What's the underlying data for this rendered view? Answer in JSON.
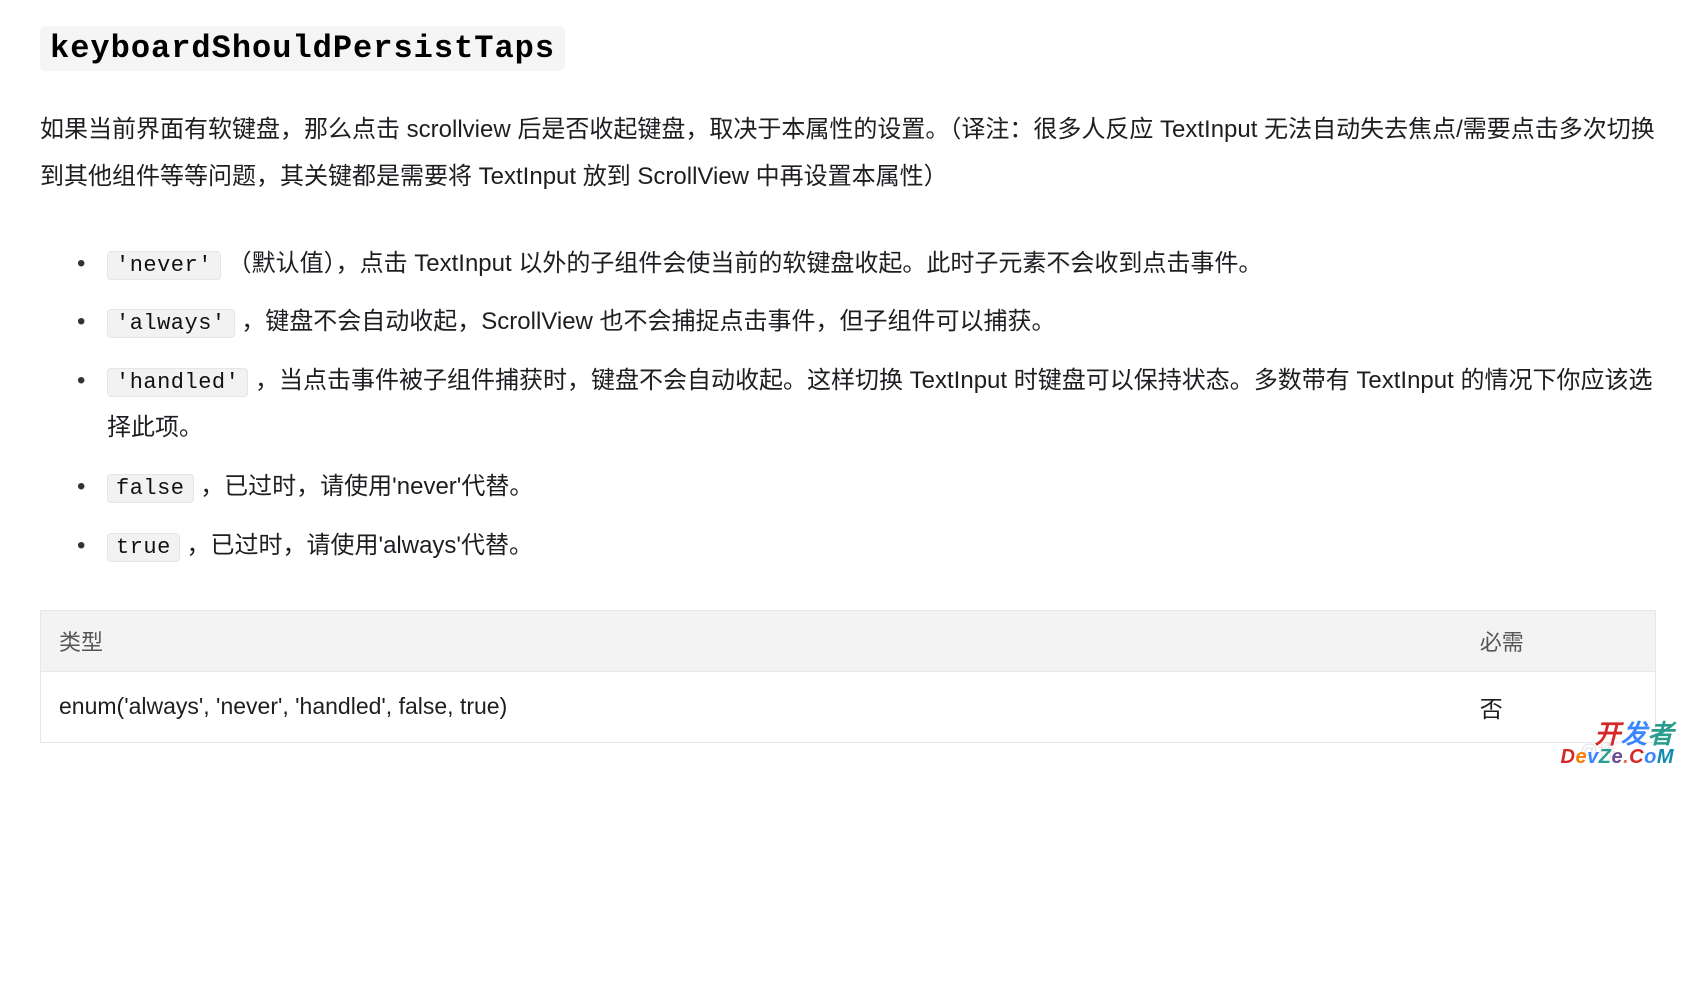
{
  "heading": "keyboardShouldPersistTaps",
  "description": "如果当前界面有软键盘，那么点击 scrollview 后是否收起键盘，取决于本属性的设置。（译注：很多人反应 TextInput 无法自动失去焦点/需要点击多次切换到其他组件等等问题，其关键都是需要将 TextInput 放到 ScrollView 中再设置本属性）",
  "bullets": [
    {
      "code": "'never'",
      "text": "（默认值），点击 TextInput 以外的子组件会使当前的软键盘收起。此时子元素不会收到点击事件。"
    },
    {
      "code": "'always'",
      "text": "，键盘不会自动收起，ScrollView 也不会捕捉点击事件，但子组件可以捕获。"
    },
    {
      "code": "'handled'",
      "text": "，当点击事件被子组件捕获时，键盘不会自动收起。这样切换 TextInput 时键盘可以保持状态。多数带有 TextInput 的情况下你应该选择此项。"
    },
    {
      "code": "false",
      "text": "，已过时，请使用'never'代替。"
    },
    {
      "code": "true",
      "text": "，已过时，请使用'always'代替。"
    }
  ],
  "table": {
    "headers": {
      "type": "类型",
      "required": "必需"
    },
    "row": {
      "type": "enum('always', 'never', 'handled', false, true)",
      "required": "否"
    }
  },
  "watermark": {
    "faint": "@稀",
    "line1_chars": [
      "开",
      "发",
      "者"
    ],
    "line2_chars": [
      "D",
      "e",
      "v",
      "Z",
      "e",
      ".",
      "C",
      "o",
      "M"
    ]
  }
}
